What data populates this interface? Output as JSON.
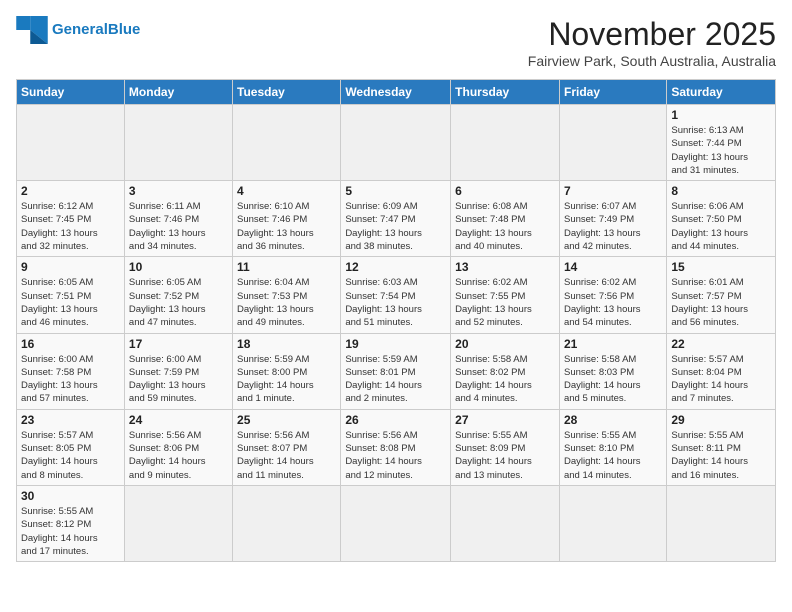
{
  "header": {
    "logo_general": "General",
    "logo_blue": "Blue",
    "month": "November 2025",
    "location": "Fairview Park, South Australia, Australia"
  },
  "days_of_week": [
    "Sunday",
    "Monday",
    "Tuesday",
    "Wednesday",
    "Thursday",
    "Friday",
    "Saturday"
  ],
  "weeks": [
    [
      {
        "day": "",
        "info": ""
      },
      {
        "day": "",
        "info": ""
      },
      {
        "day": "",
        "info": ""
      },
      {
        "day": "",
        "info": ""
      },
      {
        "day": "",
        "info": ""
      },
      {
        "day": "",
        "info": ""
      },
      {
        "day": "1",
        "info": "Sunrise: 6:13 AM\nSunset: 7:44 PM\nDaylight: 13 hours\nand 31 minutes."
      }
    ],
    [
      {
        "day": "2",
        "info": "Sunrise: 6:12 AM\nSunset: 7:45 PM\nDaylight: 13 hours\nand 32 minutes."
      },
      {
        "day": "3",
        "info": "Sunrise: 6:11 AM\nSunset: 7:46 PM\nDaylight: 13 hours\nand 34 minutes."
      },
      {
        "day": "4",
        "info": "Sunrise: 6:10 AM\nSunset: 7:46 PM\nDaylight: 13 hours\nand 36 minutes."
      },
      {
        "day": "5",
        "info": "Sunrise: 6:09 AM\nSunset: 7:47 PM\nDaylight: 13 hours\nand 38 minutes."
      },
      {
        "day": "6",
        "info": "Sunrise: 6:08 AM\nSunset: 7:48 PM\nDaylight: 13 hours\nand 40 minutes."
      },
      {
        "day": "7",
        "info": "Sunrise: 6:07 AM\nSunset: 7:49 PM\nDaylight: 13 hours\nand 42 minutes."
      },
      {
        "day": "8",
        "info": "Sunrise: 6:06 AM\nSunset: 7:50 PM\nDaylight: 13 hours\nand 44 minutes."
      }
    ],
    [
      {
        "day": "9",
        "info": "Sunrise: 6:05 AM\nSunset: 7:51 PM\nDaylight: 13 hours\nand 46 minutes."
      },
      {
        "day": "10",
        "info": "Sunrise: 6:05 AM\nSunset: 7:52 PM\nDaylight: 13 hours\nand 47 minutes."
      },
      {
        "day": "11",
        "info": "Sunrise: 6:04 AM\nSunset: 7:53 PM\nDaylight: 13 hours\nand 49 minutes."
      },
      {
        "day": "12",
        "info": "Sunrise: 6:03 AM\nSunset: 7:54 PM\nDaylight: 13 hours\nand 51 minutes."
      },
      {
        "day": "13",
        "info": "Sunrise: 6:02 AM\nSunset: 7:55 PM\nDaylight: 13 hours\nand 52 minutes."
      },
      {
        "day": "14",
        "info": "Sunrise: 6:02 AM\nSunset: 7:56 PM\nDaylight: 13 hours\nand 54 minutes."
      },
      {
        "day": "15",
        "info": "Sunrise: 6:01 AM\nSunset: 7:57 PM\nDaylight: 13 hours\nand 56 minutes."
      }
    ],
    [
      {
        "day": "16",
        "info": "Sunrise: 6:00 AM\nSunset: 7:58 PM\nDaylight: 13 hours\nand 57 minutes."
      },
      {
        "day": "17",
        "info": "Sunrise: 6:00 AM\nSunset: 7:59 PM\nDaylight: 13 hours\nand 59 minutes."
      },
      {
        "day": "18",
        "info": "Sunrise: 5:59 AM\nSunset: 8:00 PM\nDaylight: 14 hours\nand 1 minute."
      },
      {
        "day": "19",
        "info": "Sunrise: 5:59 AM\nSunset: 8:01 PM\nDaylight: 14 hours\nand 2 minutes."
      },
      {
        "day": "20",
        "info": "Sunrise: 5:58 AM\nSunset: 8:02 PM\nDaylight: 14 hours\nand 4 minutes."
      },
      {
        "day": "21",
        "info": "Sunrise: 5:58 AM\nSunset: 8:03 PM\nDaylight: 14 hours\nand 5 minutes."
      },
      {
        "day": "22",
        "info": "Sunrise: 5:57 AM\nSunset: 8:04 PM\nDaylight: 14 hours\nand 7 minutes."
      }
    ],
    [
      {
        "day": "23",
        "info": "Sunrise: 5:57 AM\nSunset: 8:05 PM\nDaylight: 14 hours\nand 8 minutes."
      },
      {
        "day": "24",
        "info": "Sunrise: 5:56 AM\nSunset: 8:06 PM\nDaylight: 14 hours\nand 9 minutes."
      },
      {
        "day": "25",
        "info": "Sunrise: 5:56 AM\nSunset: 8:07 PM\nDaylight: 14 hours\nand 11 minutes."
      },
      {
        "day": "26",
        "info": "Sunrise: 5:56 AM\nSunset: 8:08 PM\nDaylight: 14 hours\nand 12 minutes."
      },
      {
        "day": "27",
        "info": "Sunrise: 5:55 AM\nSunset: 8:09 PM\nDaylight: 14 hours\nand 13 minutes."
      },
      {
        "day": "28",
        "info": "Sunrise: 5:55 AM\nSunset: 8:10 PM\nDaylight: 14 hours\nand 14 minutes."
      },
      {
        "day": "29",
        "info": "Sunrise: 5:55 AM\nSunset: 8:11 PM\nDaylight: 14 hours\nand 16 minutes."
      }
    ],
    [
      {
        "day": "30",
        "info": "Sunrise: 5:55 AM\nSunset: 8:12 PM\nDaylight: 14 hours\nand 17 minutes."
      },
      {
        "day": "",
        "info": ""
      },
      {
        "day": "",
        "info": ""
      },
      {
        "day": "",
        "info": ""
      },
      {
        "day": "",
        "info": ""
      },
      {
        "day": "",
        "info": ""
      },
      {
        "day": "",
        "info": ""
      }
    ]
  ]
}
